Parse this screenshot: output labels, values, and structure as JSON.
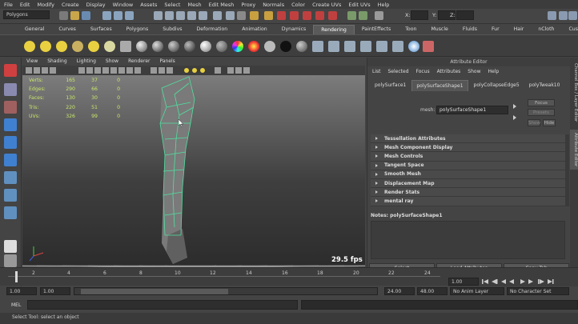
{
  "menubar": [
    "File",
    "Edit",
    "Modify",
    "Create",
    "Display",
    "Window",
    "Assets",
    "Select",
    "Mesh",
    "Edit Mesh",
    "Proxy",
    "Normals",
    "Color",
    "Create UVs",
    "Edit UVs",
    "Help"
  ],
  "mode_select": "Polygons",
  "status_fields": {
    "x": "X:",
    "y": "Y:",
    "z": "Z:"
  },
  "shelf_tabs": [
    "General",
    "Curves",
    "Surfaces",
    "Polygons",
    "Subdivs",
    "Deformation",
    "Animation",
    "Dynamics",
    "Rendering",
    "PaintEffects",
    "Toon",
    "Muscle",
    "Fluids",
    "Fur",
    "Hair",
    "nCloth",
    "Custom"
  ],
  "active_shelf_tab": "Rendering",
  "viewport_menu": [
    "View",
    "Shading",
    "Lighting",
    "Show",
    "Renderer",
    "Panels"
  ],
  "hud": [
    {
      "label": "Verts:",
      "a": "165",
      "b": "37",
      "c": "0"
    },
    {
      "label": "Edges:",
      "a": "290",
      "b": "66",
      "c": "0"
    },
    {
      "label": "Faces:",
      "a": "130",
      "b": "30",
      "c": "0"
    },
    {
      "label": "Tris:",
      "a": "220",
      "b": "51",
      "c": "0"
    },
    {
      "label": "UVs:",
      "a": "326",
      "b": "99",
      "c": "0"
    }
  ],
  "fps": "29.5 fps",
  "attr": {
    "title": "Attribute Editor",
    "menu": [
      "List",
      "Selected",
      "Focus",
      "Attributes",
      "Show",
      "Help"
    ],
    "tabs": [
      "polySurface1",
      "polySurfaceShape1",
      "polyCollapseEdge5",
      "polyTweak10"
    ],
    "active_tab": "polySurfaceShape1",
    "mesh_label": "mesh:",
    "mesh_value": "polySurfaceShape1",
    "focus": "Focus",
    "presets": "Presets",
    "show": "Show",
    "hide": "Hide",
    "sections": [
      "Tessellation Attributes",
      "Mesh Component Display",
      "Mesh Controls",
      "Tangent Space",
      "Smooth Mesh",
      "Displacement Map",
      "Render Stats",
      "mental ray"
    ],
    "notes": "Notes:  polySurfaceShape1",
    "buttons": [
      "Select",
      "Load Attributes",
      "Copy Tab"
    ]
  },
  "side_tabs": [
    "Channel Box / Layer Editor",
    "Attribute Editor"
  ],
  "timeline_ticks": [
    "2",
    "4",
    "6",
    "8",
    "10",
    "12",
    "14",
    "16",
    "18",
    "20",
    "22",
    "24"
  ],
  "current_frame": "1.00",
  "range": {
    "start": "1.00",
    "start2": "1.00",
    "inner_start": "1",
    "inner_end": "24",
    "end": "24.00",
    "end2": "48.00",
    "anim_layer": "No Anim Layer",
    "char_set": "No Character Set"
  },
  "cmd_label": "MEL",
  "help_line": "Select Tool: select an object",
  "colors": {
    "wire": "#4fe0a0",
    "hud": "#c8e66a",
    "accent": "#5a8fd0"
  }
}
